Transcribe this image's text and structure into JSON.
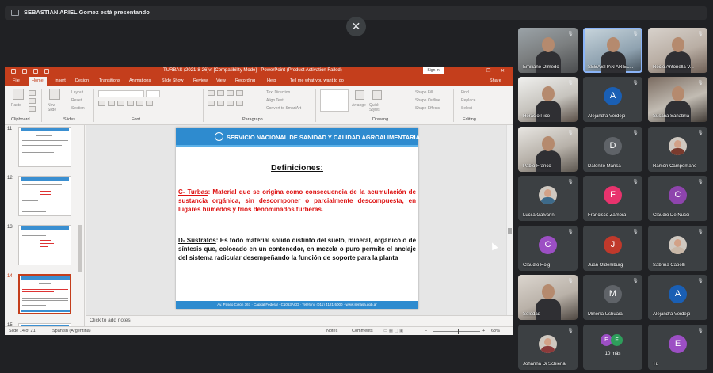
{
  "meeting": {
    "presenting_text": "SEBASTIAN ARIEL Gomez está presentando",
    "close_symbol": "✕"
  },
  "ppt": {
    "window_title": "TURBAS (2021-8-26)vf [Compatibility Mode]  -  PowerPoint (Product Activation Failed)",
    "sign_in": "Sign in",
    "win_controls": [
      "—",
      "❐",
      "✕"
    ],
    "menu_tabs": [
      "File",
      "Home",
      "Insert",
      "Design",
      "Transitions",
      "Animations",
      "Slide Show",
      "Review",
      "View",
      "Recording",
      "Help"
    ],
    "active_tab": "Home",
    "tell_me": "Tell me what you want to do",
    "share": "Share",
    "ribbon_groups": [
      "Clipboard",
      "Slides",
      "Font",
      "Paragraph",
      "Drawing",
      "Editing"
    ],
    "ribbon_buttons": {
      "paste": "Paste",
      "new_slide": "New Slide",
      "layout": "Layout",
      "reset": "Reset",
      "section": "Section",
      "text_direction": "Text Direction",
      "align_text": "Align Text",
      "convert_smartart": "Convert to SmartArt",
      "arrange": "Arrange",
      "quick_styles": "Quick Styles",
      "shape_fill": "Shape Fill",
      "shape_outline": "Shape Outline",
      "shape_effects": "Shape Effects",
      "find": "Find",
      "replace": "Replace",
      "select": "Select"
    },
    "thumbnail_numbers": [
      "11",
      "12",
      "13",
      "14",
      "15"
    ],
    "selected_slide": "14",
    "slide": {
      "org": "SERVICIO NACIONAL DE SANIDAD Y CALIDAD AGROALIMENTARIA",
      "title": "Definiciones:",
      "def1_term": "C-  Turbas",
      "def1_text": ":  Material que se origina como consecuencia de la acumulación de sustancia orgánica, sin descomponer o parcialmente descompuesta, en lugares húmedos y fríos denominados turberas.",
      "def2_term": "D-  Sustratos",
      "def2_text": ": Es todo material solidó distinto del suelo, mineral, orgánico o de síntesis que, colocado en un contenedor, en mezcla o puro permite el anclaje del sistema radicular desempeñando la función de soporte para la planta",
      "footer": "Av. Paseo Colón 367  ·  Capital Federal  ·  C1063ACD  ·  Teléfono (011) 4121-5000  ·  www.senasa.gob.ar"
    },
    "notes_placeholder": "Click to add notes",
    "status": {
      "slide_counter": "Slide 14 of 21",
      "language": "Spanish (Argentina)",
      "notes": "Notes",
      "comments": "Comments",
      "zoom": "68%"
    }
  },
  "participants": [
    {
      "name": "Emiliano Olmedo",
      "type": "video"
    },
    {
      "name": "SEBASTIAN ARIEL...",
      "type": "video",
      "speaking": true
    },
    {
      "name": "Rocio Antonella V...",
      "type": "video"
    },
    {
      "name": "Horacio Pico",
      "type": "video"
    },
    {
      "name": "Alejandra Verdejo",
      "type": "avatar",
      "initial": "A",
      "color": "#1a5fb4"
    },
    {
      "name": "Susana Sanabria",
      "type": "video"
    },
    {
      "name": "Pablo Franco",
      "type": "video"
    },
    {
      "name": "Dalonzo Marisa",
      "type": "avatar",
      "initial": "D",
      "color": "#5f6368"
    },
    {
      "name": "Ramón Campomane",
      "type": "photo"
    },
    {
      "name": "Lucila Galvarini",
      "type": "photo"
    },
    {
      "name": "Francisco Zamora",
      "type": "avatar",
      "initial": "F",
      "color": "#e8336d"
    },
    {
      "name": "Claudio De Nucci",
      "type": "avatar",
      "initial": "C",
      "color": "#8e44ad"
    },
    {
      "name": "Claudio Roig",
      "type": "avatar",
      "initial": "C",
      "color": "#9c4fc4"
    },
    {
      "name": "Juan Oldemburg",
      "type": "avatar",
      "initial": "J",
      "color": "#c0392b"
    },
    {
      "name": "Sabrina Capelli",
      "type": "photo"
    },
    {
      "name": "Soledad",
      "type": "video"
    },
    {
      "name": "Minería Ushuaia",
      "type": "avatar",
      "initial": "M",
      "color": "#5f6368"
    },
    {
      "name": "Alejandra Verdejo",
      "type": "avatar",
      "initial": "A",
      "color": "#1a5fb4"
    },
    {
      "name": "Johanna Di Schiena",
      "type": "photo"
    },
    {
      "name": "10 más",
      "type": "more",
      "initials": [
        "E",
        "F"
      ],
      "colors": [
        "#9c4fc4",
        "#2e9e5b"
      ]
    },
    {
      "name": "Tú",
      "type": "avatar",
      "initial": "E",
      "color": "#9c4fc4"
    }
  ]
}
